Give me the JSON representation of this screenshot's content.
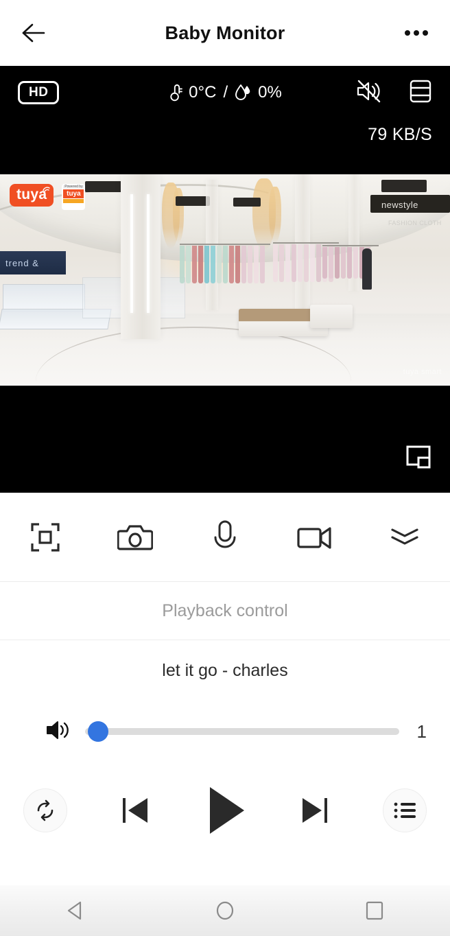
{
  "header": {
    "back_icon": "back-arrow-icon",
    "title": "Baby Monitor",
    "more_icon": "more-options-icon"
  },
  "video": {
    "quality_badge": "HD",
    "temperature": "0°C",
    "separator": "/",
    "humidity": "0%",
    "thermometer_icon": "thermometer-icon",
    "humidity_icon": "humidity-droplet-icon",
    "mute_icon": "speaker-muted-icon",
    "split_view_icon": "split-screen-icon",
    "bitrate": "79 KB/S",
    "pip_icon": "picture-in-picture-icon",
    "watermark_primary": "tuya",
    "watermark_secondary_top": "Powered by",
    "watermark_secondary_main": "tuya",
    "scene_signs": {
      "left_blue": "trend &",
      "right_store": "newstyle",
      "right_small": "FASHION CLOTH",
      "corner_text": "tuya smart"
    }
  },
  "toolbar": {
    "items": [
      {
        "name": "fullscreen-button",
        "icon": "fullscreen-frame-icon"
      },
      {
        "name": "snapshot-button",
        "icon": "camera-icon"
      },
      {
        "name": "talk-button",
        "icon": "microphone-icon"
      },
      {
        "name": "record-button",
        "icon": "video-camera-icon"
      },
      {
        "name": "expand-button",
        "icon": "double-chevron-down-icon"
      }
    ]
  },
  "playback": {
    "label": "Playback control"
  },
  "music": {
    "track_title": "let it go - charles",
    "volume_icon": "speaker-volume-icon",
    "volume_value": "1",
    "volume_percent": 0,
    "thumb_color": "#3375e0",
    "track_color": "#dcdcdc",
    "controls": {
      "repeat": "repeat-icon",
      "previous": "previous-track-icon",
      "play": "play-icon",
      "next": "next-track-icon",
      "playlist": "playlist-icon"
    }
  },
  "navbar": {
    "back": "nav-back-icon",
    "home": "nav-home-icon",
    "recents": "nav-recents-icon"
  }
}
